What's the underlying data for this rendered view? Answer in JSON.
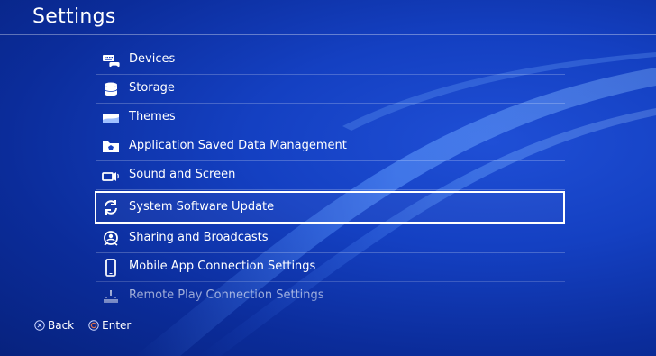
{
  "header": {
    "title": "Settings"
  },
  "menu": {
    "items": [
      {
        "label": "Devices",
        "icon": "devices-icon"
      },
      {
        "label": "Storage",
        "icon": "storage-icon"
      },
      {
        "label": "Themes",
        "icon": "themes-icon"
      },
      {
        "label": "Application Saved Data Management",
        "icon": "folder-icon"
      },
      {
        "label": "Sound and Screen",
        "icon": "sound-screen-icon"
      },
      {
        "label": "System Software Update",
        "icon": "update-icon",
        "selected": true
      },
      {
        "label": "Sharing and Broadcasts",
        "icon": "sharing-icon"
      },
      {
        "label": "Mobile App Connection Settings",
        "icon": "mobile-icon"
      },
      {
        "label": "Remote Play Connection Settings",
        "icon": "remote-play-icon"
      }
    ]
  },
  "footer": {
    "back_label": "Back",
    "enter_label": "Enter",
    "back_button_icon": "circle-x-button-icon",
    "enter_button_icon": "circle-button-icon"
  },
  "colors": {
    "background": "#1440c2",
    "background_dark": "#07227e",
    "text": "#ffffff",
    "selection_border": "#ffffff",
    "enter_glyph": "#e0704a"
  }
}
